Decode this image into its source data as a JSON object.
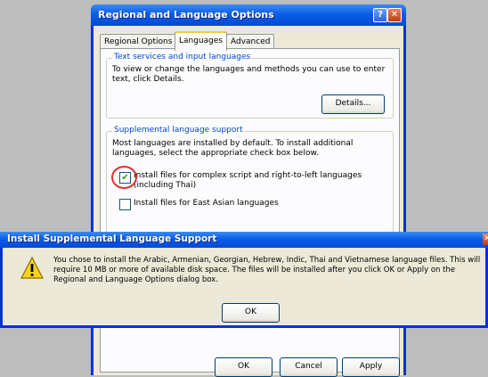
{
  "main_window": {
    "title": "Regional and Language Options",
    "help_label": "?",
    "close_label": "✕",
    "tabs": [
      {
        "label": "Regional Options"
      },
      {
        "label": "Languages"
      },
      {
        "label": "Advanced"
      }
    ],
    "text_services": {
      "title": "Text services and input languages",
      "description": "To view or change the languages and methods you can use to enter text, click Details.",
      "details_button": "Details..."
    },
    "supplemental": {
      "title": "Supplemental language support",
      "description": "Most languages are installed by default. To install additional languages, select the appropriate check box below.",
      "complex_script_label": "Install files for complex script and right-to-left languages (including Thai)",
      "complex_script_checked": true,
      "east_asian_label": "Install files for East Asian languages",
      "east_asian_checked": false
    },
    "buttons": {
      "ok": "OK",
      "cancel": "Cancel",
      "apply": "Apply"
    }
  },
  "dialog": {
    "title": "Install Supplemental Language Support",
    "close_label": "✕",
    "icon": "warning-icon",
    "message": "You chose to install the Arabic, Armenian, Georgian, Hebrew, Indic, Thai and Vietnamese language files. This will require 10 MB or more of available disk space. The files will be installed after you click OK or Apply on the Regional and Language Options dialog box.",
    "ok_button": "OK"
  },
  "colors": {
    "titlebar": "#0a5ee6",
    "dialog_face": "#ece9d8",
    "highlight": "#e03030"
  }
}
